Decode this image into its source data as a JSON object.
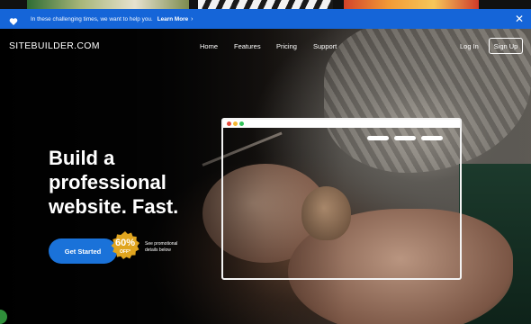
{
  "notice": {
    "message": "In these challenging times, we want to help you.",
    "link": "Learn More",
    "chevron": "›",
    "close": "✕",
    "icon": "heart-icon"
  },
  "nav": {
    "logo": "SITEBUILDER",
    "logo_suffix": ".COM",
    "items": [
      "Home",
      "Features",
      "Pricing",
      "Support"
    ],
    "login": "Log In",
    "signup": "Sign Up"
  },
  "hero": {
    "headline": [
      "Build a",
      "professional",
      "website. Fast."
    ],
    "cta": "Get Started",
    "badge_percent": "60%",
    "badge_off": "OFF*",
    "promo": "See promotional details below"
  },
  "colors": {
    "notice_bg": "#1565d8",
    "cta_bg": "#1a72d9",
    "badge": "#e0a51f"
  }
}
